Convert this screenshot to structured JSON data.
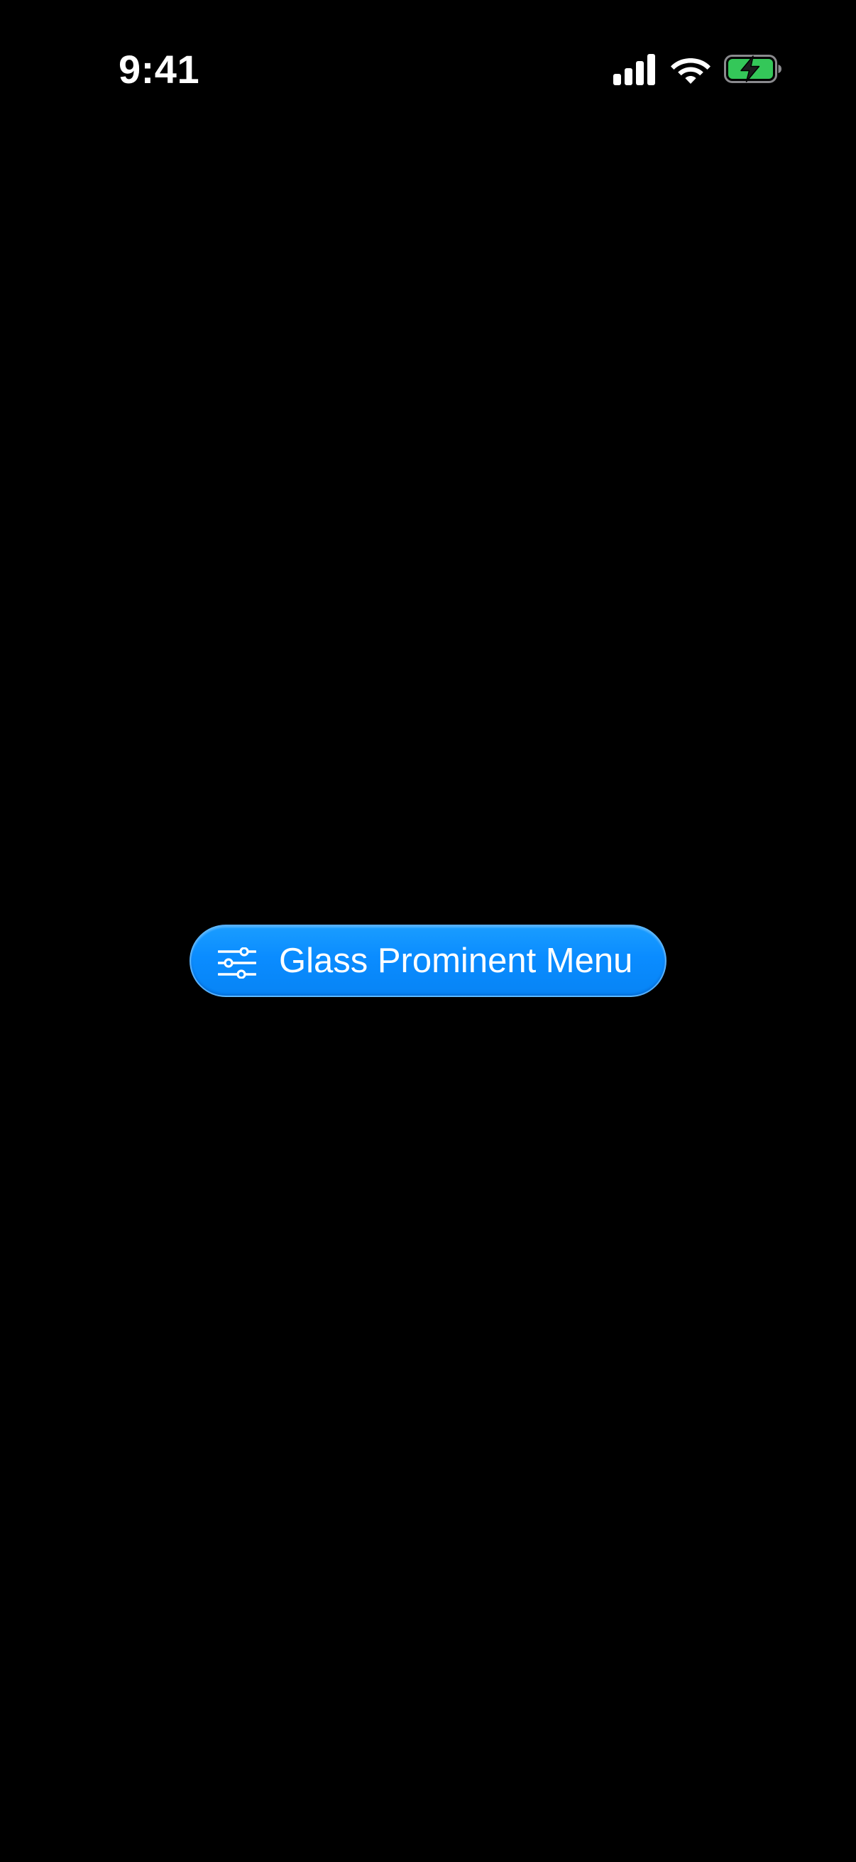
{
  "status_bar": {
    "time": "9:41",
    "signal_icon": "cellular-signal-icon",
    "wifi_icon": "wifi-icon",
    "battery_icon": "battery-charging-icon",
    "battery_color": "#34c759"
  },
  "main": {
    "menu_button": {
      "label": "Glass Prominent Menu",
      "icon": "sliders-icon",
      "background_color": "#0a8cff"
    }
  },
  "colors": {
    "background": "#000000",
    "text": "#ffffff",
    "accent": "#0a8cff"
  }
}
